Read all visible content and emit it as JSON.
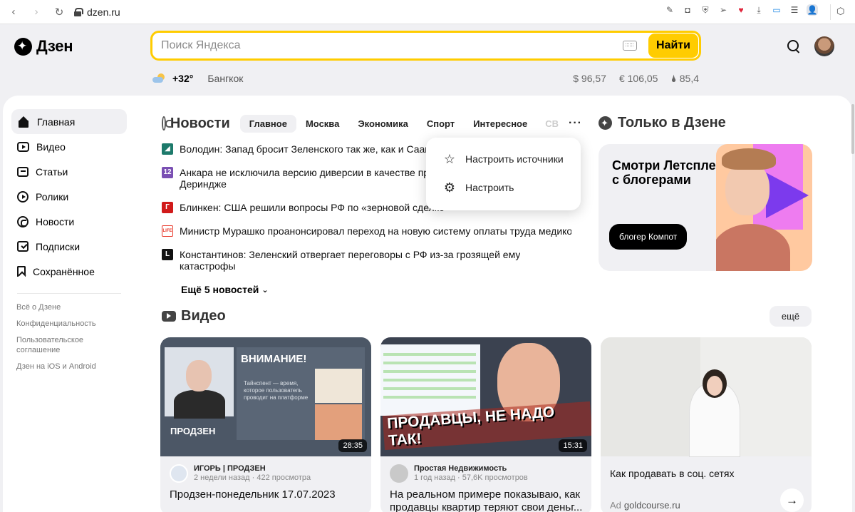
{
  "browser": {
    "url": "dzen.ru",
    "back_icon": "arrow-left-icon",
    "forward_icon": "arrow-right-icon",
    "reload_icon": "reload-icon"
  },
  "header": {
    "logo_text": "Дзен",
    "search": {
      "placeholder": "Поиск Яндекса",
      "value": "",
      "button_label": "Найти"
    },
    "weather": {
      "temp": "+32°",
      "city": "Бангкок"
    },
    "rates": [
      "$ 96,57",
      "€ 106,05",
      "🌢 85,4"
    ]
  },
  "sidebar": {
    "items": [
      {
        "label": "Главная",
        "icon": "home-icon",
        "active": true
      },
      {
        "label": "Видео",
        "icon": "video-icon"
      },
      {
        "label": "Статьи",
        "icon": "articles-icon"
      },
      {
        "label": "Ролики",
        "icon": "reels-icon"
      },
      {
        "label": "Новости",
        "icon": "news-icon"
      },
      {
        "label": "Подписки",
        "icon": "subscriptions-icon"
      },
      {
        "label": "Сохранённое",
        "icon": "bookmark-icon"
      }
    ],
    "links": [
      "Всё о Дзене",
      "Конфиденциальность",
      "Пользовательское соглашение",
      "Дзен на iOS и Android"
    ]
  },
  "news": {
    "title": "Новости",
    "tabs": [
      "Главное",
      "Москва",
      "Экономика",
      "Спорт",
      "Интересное",
      "СВ"
    ],
    "items": [
      {
        "text": "Володин: Запад бросит Зеленского так же, как и Саакашвили",
        "source_color": "#1d7a6b",
        "source_mark": "◢"
      },
      {
        "text": "Анкара не исключила версию диверсии в качестве причины обрушения",
        "text2": "Дериндже",
        "source_color": "#7a4fb3",
        "source_mark": "12"
      },
      {
        "text": "Блинкен: США решили вопросы РФ по «зерновой сделке»",
        "source_color": "#d11a1a",
        "source_mark": "Г"
      },
      {
        "text": "Министр Мурашко проанонсировал переход на новую систему оплаты труда медиков",
        "source_color": "#e8382a",
        "source_mark": "LIFE"
      },
      {
        "text": "Константинов: Зеленский отвергает переговоры с РФ из-за грозящей ему",
        "text2": "катастрофы",
        "source_color": "#111111",
        "source_mark": "L"
      }
    ],
    "more_label": "Ещё 5 новостей"
  },
  "dropdown": {
    "items": [
      {
        "label": "Настроить источники",
        "icon": "star-icon"
      },
      {
        "label": "Настроить",
        "icon": "gear-icon"
      }
    ]
  },
  "zen_only": {
    "title": "Только в Дзене",
    "promo_text": "Смотри Летсплеи с блогерами",
    "chip": "блогер Компот"
  },
  "video": {
    "title": "Видео",
    "more_label": "ещё",
    "cards": [
      {
        "duration": "28:35",
        "channel": "ИГОРЬ | ПРОДЗЕН",
        "meta": "2 недели назад · 422 просмотра",
        "title": "Продзен-понедельник 17.07.2023",
        "thumb_heading": "ВНИМАНИЕ!",
        "thumb_body": "Тайнспент — время, которое пользователь проводит на платформе",
        "thumb_brand": "ПРОДЗЕН"
      },
      {
        "duration": "15:31",
        "channel": "Простая Недвижимость",
        "meta": "1 год назад · 57,6K просмотров",
        "title": "На реальном примере показываю, как продавцы квартир теряют свои деньг...",
        "thumb_banner": "ПРОДАВЦЫ, НЕ НАДО ТАК!"
      },
      {
        "ad_title": "Как продавать в соц. сетях",
        "ad_label": "Ad",
        "ad_source": "goldcourse.ru"
      }
    ]
  }
}
